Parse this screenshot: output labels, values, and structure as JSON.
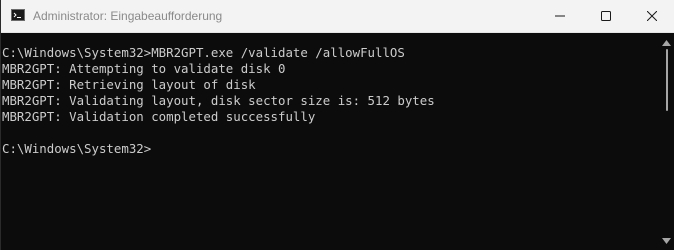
{
  "window": {
    "title": "Administrator: Eingabeaufforderung",
    "icon": "command-prompt-icon",
    "controls": {
      "minimize": "minimize-icon",
      "maximize": "maximize-icon",
      "close": "close-icon"
    }
  },
  "console": {
    "lines": [
      "C:\\Windows\\System32>MBR2GPT.exe /validate /allowFullOS",
      "MBR2GPT: Attempting to validate disk 0",
      "MBR2GPT: Retrieving layout of disk",
      "MBR2GPT: Validating layout, disk sector size is: 512 bytes",
      "MBR2GPT: Validation completed successfully",
      "",
      "C:\\Windows\\System32>"
    ]
  },
  "colors": {
    "console_background": "#0c0c0c",
    "console_text": "#cccccc",
    "titlebar_background": "#f3f3f3"
  }
}
